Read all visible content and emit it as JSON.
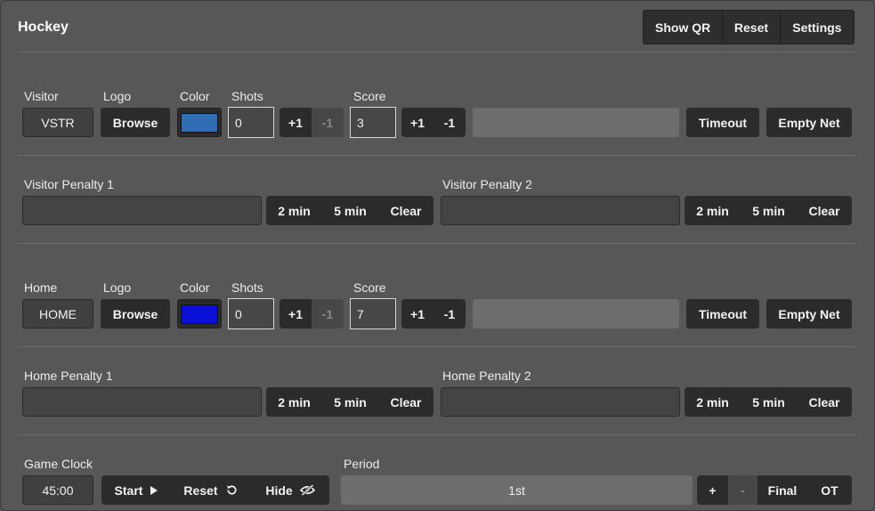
{
  "app": {
    "title": "Hockey"
  },
  "header_buttons": {
    "show_qr": "Show QR",
    "reset": "Reset",
    "settings": "Settings"
  },
  "visitor": {
    "team_label": "Visitor",
    "team_value": "VSTR",
    "logo_label": "Logo",
    "browse": "Browse",
    "color_label": "Color",
    "color": "#2f6db5",
    "shots_label": "Shots",
    "shots_value": "0",
    "shots_plus": "+1",
    "shots_minus": "-1",
    "score_label": "Score",
    "score_value": "3",
    "score_plus": "+1",
    "score_minus": "-1",
    "timeout": "Timeout",
    "empty_net": "Empty Net",
    "penalty1_label": "Visitor Penalty 1",
    "penalty2_label": "Visitor Penalty 2",
    "two_min": "2 min",
    "five_min": "5 min",
    "clear": "Clear"
  },
  "home": {
    "team_label": "Home",
    "team_value": "HOME",
    "logo_label": "Logo",
    "browse": "Browse",
    "color_label": "Color",
    "color": "#0a10d6",
    "shots_label": "Shots",
    "shots_value": "0",
    "shots_plus": "+1",
    "shots_minus": "-1",
    "score_label": "Score",
    "score_value": "7",
    "score_plus": "+1",
    "score_minus": "-1",
    "timeout": "Timeout",
    "empty_net": "Empty Net",
    "penalty1_label": "Home Penalty 1",
    "penalty2_label": "Home Penalty 2",
    "two_min": "2 min",
    "five_min": "5 min",
    "clear": "Clear"
  },
  "clock": {
    "label": "Game Clock",
    "value": "45:00",
    "start": "Start",
    "reset": "Reset",
    "hide": "Hide"
  },
  "period": {
    "label": "Period",
    "value": "1st",
    "plus": "+",
    "minus": "-",
    "final": "Final",
    "ot": "OT"
  }
}
